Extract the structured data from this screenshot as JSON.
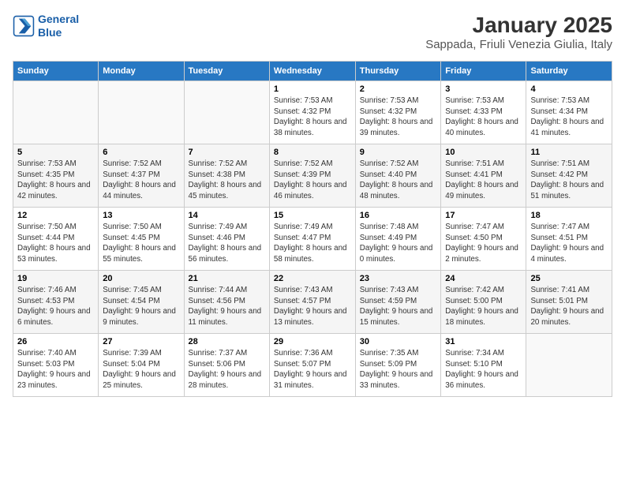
{
  "logo": {
    "line1": "General",
    "line2": "Blue"
  },
  "title": "January 2025",
  "subtitle": "Sappada, Friuli Venezia Giulia, Italy",
  "days_of_week": [
    "Sunday",
    "Monday",
    "Tuesday",
    "Wednesday",
    "Thursday",
    "Friday",
    "Saturday"
  ],
  "weeks": [
    [
      {
        "day": "",
        "info": ""
      },
      {
        "day": "",
        "info": ""
      },
      {
        "day": "",
        "info": ""
      },
      {
        "day": "1",
        "info": "Sunrise: 7:53 AM\nSunset: 4:32 PM\nDaylight: 8 hours\nand 38 minutes."
      },
      {
        "day": "2",
        "info": "Sunrise: 7:53 AM\nSunset: 4:32 PM\nDaylight: 8 hours\nand 39 minutes."
      },
      {
        "day": "3",
        "info": "Sunrise: 7:53 AM\nSunset: 4:33 PM\nDaylight: 8 hours\nand 40 minutes."
      },
      {
        "day": "4",
        "info": "Sunrise: 7:53 AM\nSunset: 4:34 PM\nDaylight: 8 hours\nand 41 minutes."
      }
    ],
    [
      {
        "day": "5",
        "info": "Sunrise: 7:53 AM\nSunset: 4:35 PM\nDaylight: 8 hours\nand 42 minutes."
      },
      {
        "day": "6",
        "info": "Sunrise: 7:52 AM\nSunset: 4:37 PM\nDaylight: 8 hours\nand 44 minutes."
      },
      {
        "day": "7",
        "info": "Sunrise: 7:52 AM\nSunset: 4:38 PM\nDaylight: 8 hours\nand 45 minutes."
      },
      {
        "day": "8",
        "info": "Sunrise: 7:52 AM\nSunset: 4:39 PM\nDaylight: 8 hours\nand 46 minutes."
      },
      {
        "day": "9",
        "info": "Sunrise: 7:52 AM\nSunset: 4:40 PM\nDaylight: 8 hours\nand 48 minutes."
      },
      {
        "day": "10",
        "info": "Sunrise: 7:51 AM\nSunset: 4:41 PM\nDaylight: 8 hours\nand 49 minutes."
      },
      {
        "day": "11",
        "info": "Sunrise: 7:51 AM\nSunset: 4:42 PM\nDaylight: 8 hours\nand 51 minutes."
      }
    ],
    [
      {
        "day": "12",
        "info": "Sunrise: 7:50 AM\nSunset: 4:44 PM\nDaylight: 8 hours\nand 53 minutes."
      },
      {
        "day": "13",
        "info": "Sunrise: 7:50 AM\nSunset: 4:45 PM\nDaylight: 8 hours\nand 55 minutes."
      },
      {
        "day": "14",
        "info": "Sunrise: 7:49 AM\nSunset: 4:46 PM\nDaylight: 8 hours\nand 56 minutes."
      },
      {
        "day": "15",
        "info": "Sunrise: 7:49 AM\nSunset: 4:47 PM\nDaylight: 8 hours\nand 58 minutes."
      },
      {
        "day": "16",
        "info": "Sunrise: 7:48 AM\nSunset: 4:49 PM\nDaylight: 9 hours\nand 0 minutes."
      },
      {
        "day": "17",
        "info": "Sunrise: 7:47 AM\nSunset: 4:50 PM\nDaylight: 9 hours\nand 2 minutes."
      },
      {
        "day": "18",
        "info": "Sunrise: 7:47 AM\nSunset: 4:51 PM\nDaylight: 9 hours\nand 4 minutes."
      }
    ],
    [
      {
        "day": "19",
        "info": "Sunrise: 7:46 AM\nSunset: 4:53 PM\nDaylight: 9 hours\nand 6 minutes."
      },
      {
        "day": "20",
        "info": "Sunrise: 7:45 AM\nSunset: 4:54 PM\nDaylight: 9 hours\nand 9 minutes."
      },
      {
        "day": "21",
        "info": "Sunrise: 7:44 AM\nSunset: 4:56 PM\nDaylight: 9 hours\nand 11 minutes."
      },
      {
        "day": "22",
        "info": "Sunrise: 7:43 AM\nSunset: 4:57 PM\nDaylight: 9 hours\nand 13 minutes."
      },
      {
        "day": "23",
        "info": "Sunrise: 7:43 AM\nSunset: 4:59 PM\nDaylight: 9 hours\nand 15 minutes."
      },
      {
        "day": "24",
        "info": "Sunrise: 7:42 AM\nSunset: 5:00 PM\nDaylight: 9 hours\nand 18 minutes."
      },
      {
        "day": "25",
        "info": "Sunrise: 7:41 AM\nSunset: 5:01 PM\nDaylight: 9 hours\nand 20 minutes."
      }
    ],
    [
      {
        "day": "26",
        "info": "Sunrise: 7:40 AM\nSunset: 5:03 PM\nDaylight: 9 hours\nand 23 minutes."
      },
      {
        "day": "27",
        "info": "Sunrise: 7:39 AM\nSunset: 5:04 PM\nDaylight: 9 hours\nand 25 minutes."
      },
      {
        "day": "28",
        "info": "Sunrise: 7:37 AM\nSunset: 5:06 PM\nDaylight: 9 hours\nand 28 minutes."
      },
      {
        "day": "29",
        "info": "Sunrise: 7:36 AM\nSunset: 5:07 PM\nDaylight: 9 hours\nand 31 minutes."
      },
      {
        "day": "30",
        "info": "Sunrise: 7:35 AM\nSunset: 5:09 PM\nDaylight: 9 hours\nand 33 minutes."
      },
      {
        "day": "31",
        "info": "Sunrise: 7:34 AM\nSunset: 5:10 PM\nDaylight: 9 hours\nand 36 minutes."
      },
      {
        "day": "",
        "info": ""
      }
    ]
  ]
}
